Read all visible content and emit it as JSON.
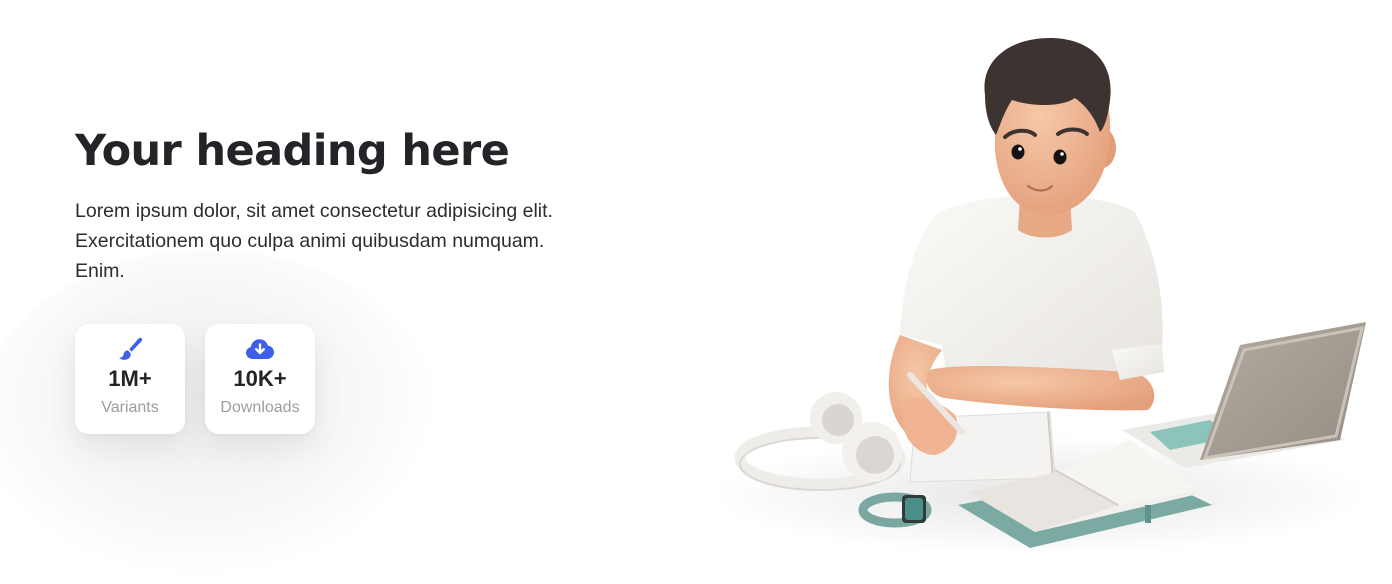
{
  "hero": {
    "title": "Your heading here",
    "description": "Lorem ipsum dolor, sit amet consectetur adipisicing elit.\nExercitationem quo culpa animi quibusdam numquam.\nEnim."
  },
  "stats": [
    {
      "icon": "paintbrush-icon",
      "value": "1M+",
      "label": "Variants"
    },
    {
      "icon": "cloud-download-icon",
      "value": "10K+",
      "label": "Downloads"
    }
  ],
  "colors": {
    "accent": "#3f5fea",
    "heading": "#222428",
    "muted": "#9a9ca1"
  }
}
